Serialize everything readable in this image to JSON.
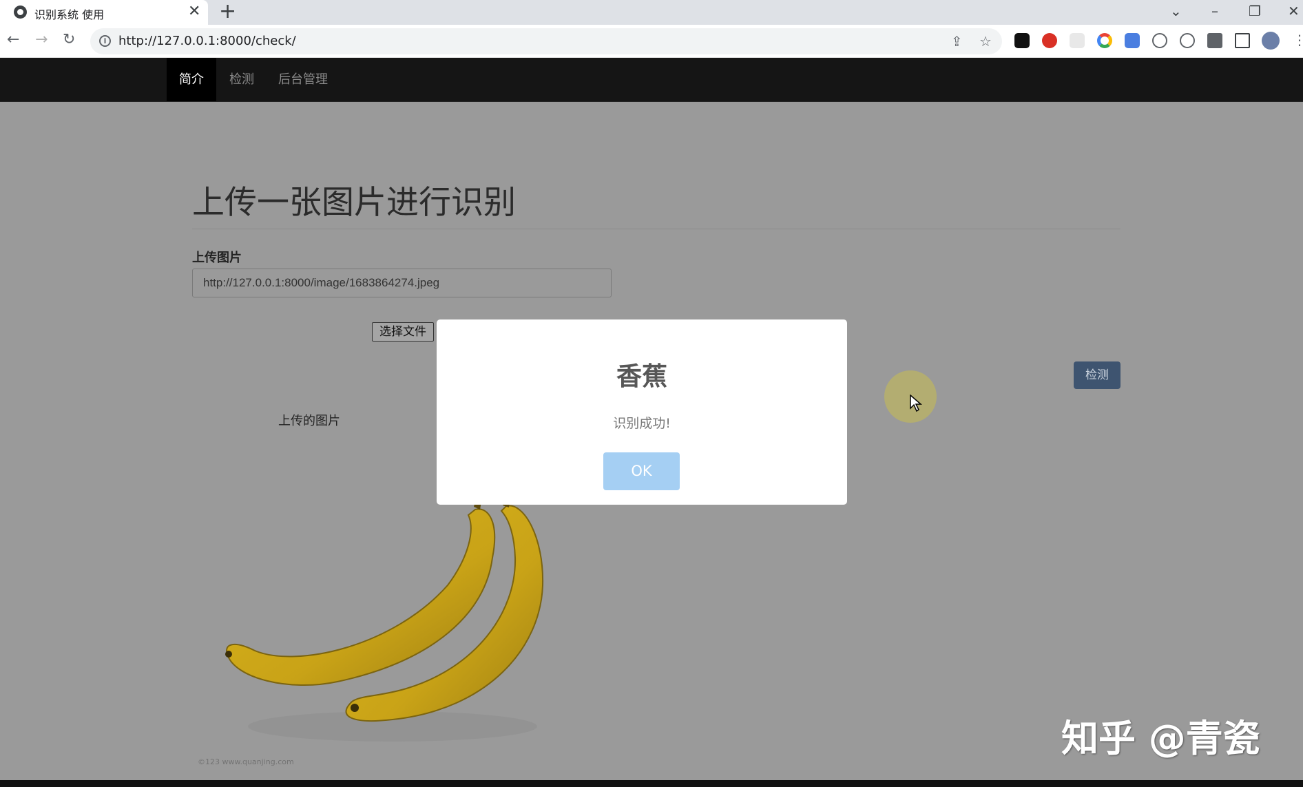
{
  "browser": {
    "tab_title": "识别系统 使用",
    "tab_close": "✕",
    "new_tab": "+",
    "url": "http://127.0.0.1:8000/check/",
    "window_controls": {
      "dropdown": "⌄",
      "minimize": "–",
      "restore": "❐",
      "close": "✕"
    },
    "extension_icons": [
      "share-icon",
      "bookmark-star-icon",
      "extension-1-icon",
      "extension-2-icon",
      "extension-3-icon",
      "chrome-icon",
      "translate-icon",
      "extension-4-icon",
      "extension-5-icon",
      "puzzle-icon",
      "sidebar-icon",
      "profile-avatar",
      "menu-icon"
    ]
  },
  "nav": {
    "items": [
      {
        "label": "简介",
        "active": true
      },
      {
        "label": "检测",
        "active": false
      },
      {
        "label": "后台管理",
        "active": false
      }
    ]
  },
  "page": {
    "title": "上传一张图片进行识别",
    "upload_label": "上传图片",
    "image_url": "http://127.0.0.1:8000/image/1683864274.jpeg",
    "choose_file": "选择文件",
    "detect": "检测",
    "uploaded_label": "上传的图片",
    "image_caption": "©123 www.quanjing.com"
  },
  "modal": {
    "title": "香蕉",
    "text": "识别成功!",
    "ok": "OK"
  },
  "watermark": "知乎 @青瓷",
  "colors": {
    "navbar": "#151515",
    "overlay_bg": "#9a9a9a",
    "detect_button": "#3e5470",
    "ok_button": "#a5cff3",
    "banana": "#e9c21e"
  }
}
